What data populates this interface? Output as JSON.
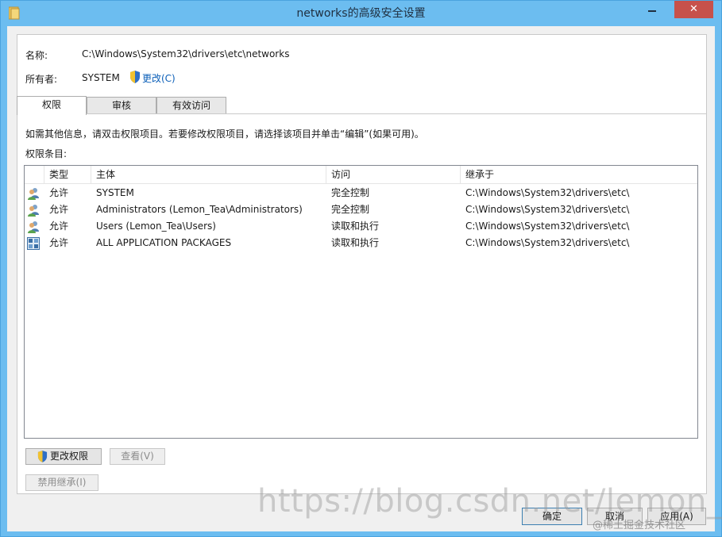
{
  "window": {
    "title": "networks的高级安全设置",
    "close_label": "✕",
    "frame_color": "#6cbdf0",
    "close_color": "#c7514b"
  },
  "info": {
    "name_label": "名称:",
    "name_value": "C:\\Windows\\System32\\drivers\\etc\\networks",
    "owner_label": "所有者:",
    "owner_value": "SYSTEM",
    "change_owner_link": "更改(C)"
  },
  "tabs": [
    {
      "label": "权限",
      "active": true
    },
    {
      "label": "审核",
      "active": false
    },
    {
      "label": "有效访问",
      "active": false
    }
  ],
  "instructions": "如需其他信息，请双击权限项目。若要修改权限项目，请选择该项目并单击“编辑”(如果可用)。",
  "entries_label": "权限条目:",
  "table": {
    "columns": [
      "类型",
      "主体",
      "访问",
      "继承于"
    ],
    "rows": [
      {
        "icon": "user-group-icon",
        "type": "允许",
        "principal": "SYSTEM",
        "access": "完全控制",
        "inherited": "C:\\Windows\\System32\\drivers\\etc\\"
      },
      {
        "icon": "user-group-icon",
        "type": "允许",
        "principal": "Administrators (Lemon_Tea\\Administrators)",
        "access": "完全控制",
        "inherited": "C:\\Windows\\System32\\drivers\\etc\\"
      },
      {
        "icon": "user-group-icon",
        "type": "允许",
        "principal": "Users (Lemon_Tea\\Users)",
        "access": "读取和执行",
        "inherited": "C:\\Windows\\System32\\drivers\\etc\\"
      },
      {
        "icon": "app-packages-icon",
        "type": "允许",
        "principal": "ALL APPLICATION PACKAGES",
        "access": "读取和执行",
        "inherited": "C:\\Windows\\System32\\drivers\\etc\\"
      }
    ]
  },
  "buttons": {
    "change_permissions": "更改权限",
    "view": "查看(V)",
    "disable_inheritance": "禁用继承(I)",
    "ok": "确定",
    "cancel": "取消",
    "apply": "应用(A)"
  },
  "watermark": {
    "url": "https://blog.csdn.net/lemon_tlee",
    "site": "@稀土掘金技术社区"
  }
}
